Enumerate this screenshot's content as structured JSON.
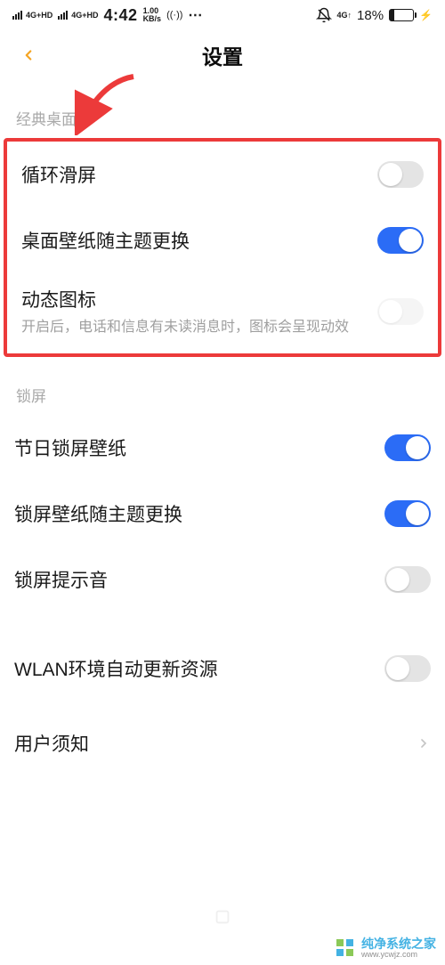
{
  "status": {
    "net_label": "4G+HD",
    "time": "4:42",
    "speed_top": "1.00",
    "speed_bot": "KB/s",
    "signal_icon": "((·))",
    "more": "⋯",
    "net2": "4G↑",
    "battery_pct": "18%",
    "charging": "⚡"
  },
  "header": {
    "title": "设置"
  },
  "sections": {
    "classic": {
      "label": "经典桌面",
      "items": [
        {
          "label": "循环滑屏",
          "on": false
        },
        {
          "label": "桌面壁纸随主题更换",
          "on": true
        },
        {
          "label": "动态图标",
          "sub": "开启后，电话和信息有未读消息时，图标会呈现动效",
          "on": false,
          "dim": true
        }
      ]
    },
    "lock": {
      "label": "锁屏",
      "items": [
        {
          "label": "节日锁屏壁纸",
          "on": true
        },
        {
          "label": "锁屏壁纸随主题更换",
          "on": true
        },
        {
          "label": "锁屏提示音",
          "on": false
        }
      ]
    },
    "other": {
      "items": [
        {
          "label": "WLAN环境自动更新资源",
          "on": false
        },
        {
          "label": "用户须知",
          "type": "nav"
        }
      ]
    }
  },
  "watermark": {
    "line1": "纯净系统之家",
    "line2": "www.ycwjz.com"
  },
  "colors": {
    "accent": "#2b6cf6",
    "back_button": "#f5a524",
    "highlight": "#ec3a3a"
  }
}
